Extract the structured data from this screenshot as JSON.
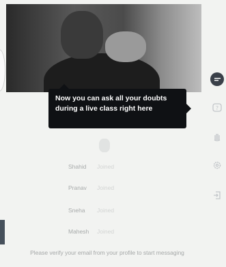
{
  "video": {
    "tooltip_text": "Now you can ask all your doubts during a live class right here"
  },
  "side_rail": {
    "icons": [
      "chat-bubble-icon",
      "question-icon",
      "raise-hand-icon",
      "settings-icon",
      "exit-icon"
    ],
    "active_color": "#3a4049"
  },
  "members": [
    {
      "name": "Shahid",
      "status": "Joined"
    },
    {
      "name": "Pranav",
      "status": "Joined"
    },
    {
      "name": "Sneha",
      "status": "Joined"
    },
    {
      "name": "Mahesh",
      "status": "Joined"
    }
  ],
  "footer": {
    "verify_text": "Please verify your email from your profile to start messaging"
  }
}
